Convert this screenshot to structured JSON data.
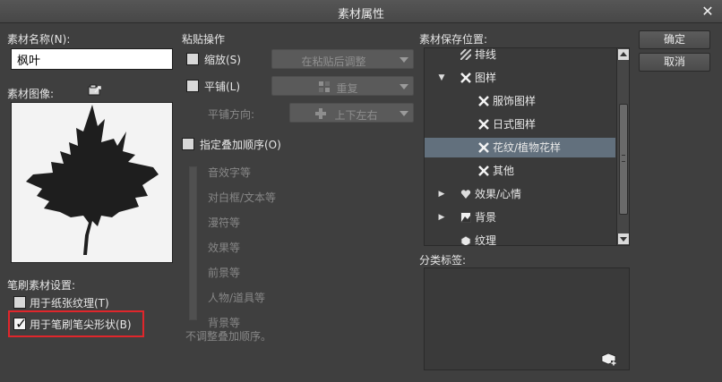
{
  "window": {
    "title": "素材属性",
    "close_glyph": "✕"
  },
  "material": {
    "name_label": "素材名称(N):",
    "name_value": "枫叶",
    "image_label": "素材图像:",
    "image_button_icon": "load-image-icon"
  },
  "brush": {
    "section_label": "笔刷素材设置:",
    "paper_texture_label": "用于纸张纹理(T)",
    "paper_texture_checked": false,
    "brush_tip_label": "用于笔刷笔尖形状(B)",
    "brush_tip_checked": true
  },
  "paste": {
    "section_label": "粘贴操作",
    "scale_label": "缩放(S)",
    "scale_value": "在粘贴后调整",
    "tile_label": "平铺(L)",
    "tile_value": "重复",
    "tile_dir_label": "平铺方向:",
    "tile_dir_value": "上下左右"
  },
  "order": {
    "label": "指定叠加顺序(O)",
    "items": [
      "音效字等",
      "对白框/文本等",
      "漫符等",
      "效果等",
      "前景等",
      "人物/道具等",
      "背景等"
    ],
    "none_label": "不调整叠加顺序。"
  },
  "location": {
    "label": "素材保存位置:",
    "tree": [
      {
        "label": "排线",
        "depth": 1,
        "expander": "",
        "icon": "hatch-icon"
      },
      {
        "label": "图样",
        "depth": 1,
        "expander": "▼",
        "icon": "pattern-icon"
      },
      {
        "label": "服饰图样",
        "depth": 2,
        "expander": "",
        "icon": "pattern-icon"
      },
      {
        "label": "日式图样",
        "depth": 2,
        "expander": "",
        "icon": "pattern-icon"
      },
      {
        "label": "花纹/植物花样",
        "depth": 2,
        "expander": "",
        "icon": "pattern-icon",
        "selected": true
      },
      {
        "label": "其他",
        "depth": 2,
        "expander": "",
        "icon": "pattern-icon"
      },
      {
        "label": "效果/心情",
        "depth": 1,
        "expander": "▶",
        "icon": "heart-icon"
      },
      {
        "label": "背景",
        "depth": 1,
        "expander": "▶",
        "icon": "background-icon"
      },
      {
        "label": "纹理",
        "depth": 1,
        "expander": "",
        "icon": "texture-icon"
      }
    ]
  },
  "tags": {
    "label": "分类标签:",
    "add_icon": "add-tag-icon"
  },
  "buttons": {
    "ok": "确定",
    "cancel": "取消"
  }
}
